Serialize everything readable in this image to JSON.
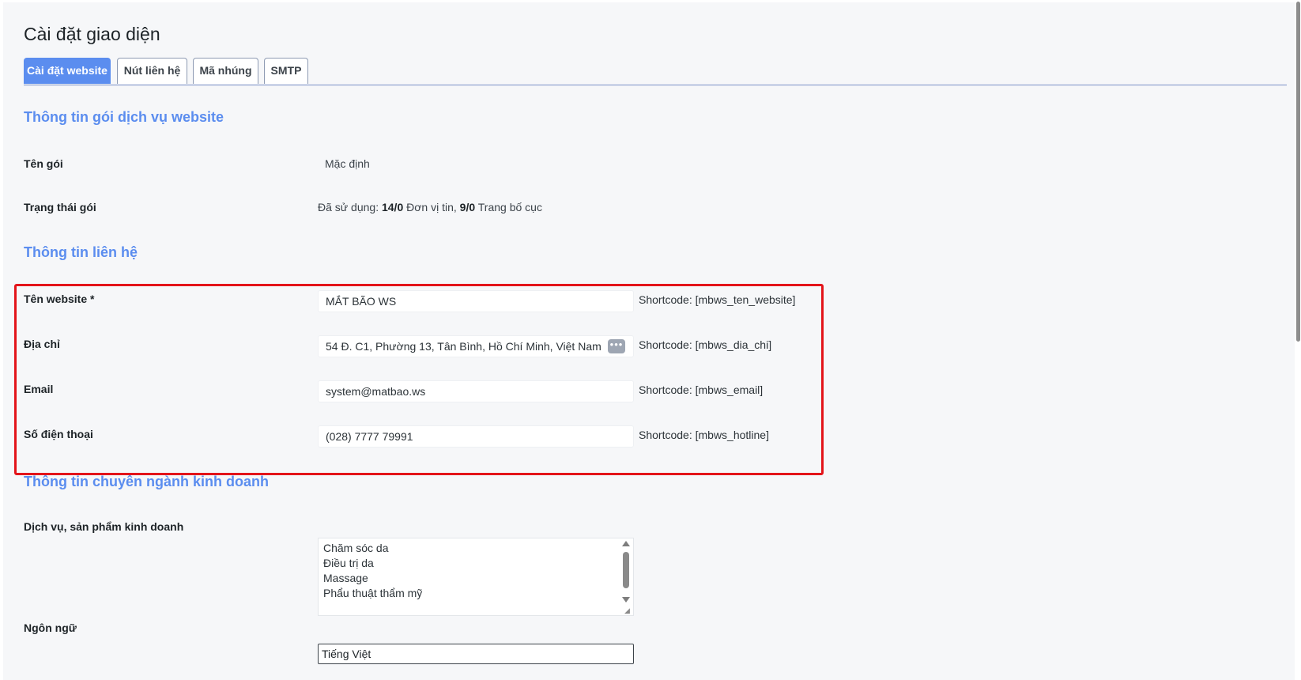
{
  "page": {
    "title": "Cài đặt giao diện"
  },
  "tabs": [
    {
      "label": "Cài đặt website",
      "active": true
    },
    {
      "label": "Nút liên hệ",
      "active": false
    },
    {
      "label": "Mã nhúng",
      "active": false
    },
    {
      "label": "SMTP",
      "active": false
    }
  ],
  "package_section": {
    "title": "Thông tin gói dịch vụ website",
    "name_label": "Tên gói",
    "name_value": "Mặc định",
    "status_label": "Trạng thái gói",
    "status_prefix": "Đã sử dụng: ",
    "status_units_count": "14/0",
    "status_units_text": " Đơn vị tin, ",
    "status_layouts_count": "9/0",
    "status_layouts_text": " Trang bố cục"
  },
  "contact_section": {
    "title": "Thông tin liên hệ",
    "fields": [
      {
        "label": "Tên website *",
        "value": "MẮT BÃO WS",
        "shortcode": "Shortcode: [mbws_ten_website]"
      },
      {
        "label": "Địa chỉ",
        "value": "54 Đ. C1, Phường 13, Tân Bình, Hồ Chí Minh, Việt Nam",
        "shortcode": "Shortcode: [mbws_dia_chi]"
      },
      {
        "label": "Email",
        "value": "system@matbao.ws",
        "shortcode": "Shortcode: [mbws_email]"
      },
      {
        "label": "Số điện thoại",
        "value": "(028) 7777 79991",
        "shortcode": "Shortcode: [mbws_hotline]"
      }
    ],
    "address_action_icon": "more-dots-icon"
  },
  "business_section": {
    "title": "Thông tin chuyên ngành kinh doanh",
    "services_label": "Dịch vụ, sản phẩm kinh doanh",
    "services": [
      "Chăm sóc da",
      "Điều trị da",
      "Massage",
      "Phẩu thuật thẩm mỹ"
    ],
    "language_label": "Ngôn ngữ",
    "language_value": "Tiếng Việt"
  },
  "colors": {
    "accent": "#5b8def",
    "highlight_border": "#e3141a",
    "background": "#f6f7f9"
  }
}
